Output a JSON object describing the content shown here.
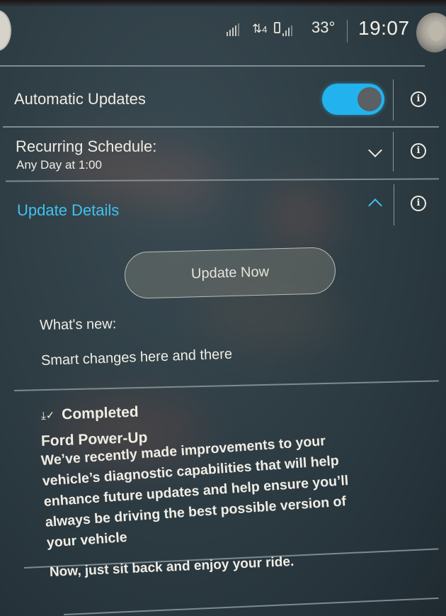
{
  "status_bar": {
    "icons": [
      "signal-bars-icon",
      "data-transfer-icon",
      "phone-signal-icon"
    ],
    "data_transfer_label": "4",
    "temperature": "33°",
    "time": "19:07",
    "avatar": "user-avatar"
  },
  "settings": {
    "automatic_updates": {
      "label": "Automatic Updates",
      "enabled": true
    },
    "recurring_schedule": {
      "label": "Recurring Schedule:",
      "value": "Any Day at 1:00",
      "expanded": false
    },
    "update_details": {
      "label": "Update Details",
      "expanded": true
    }
  },
  "details": {
    "update_now_label": "Update Now",
    "whats_new_label": "What's new:",
    "whats_new_text": "Smart changes here and there",
    "status_label": "Completed",
    "update_name": "Ford Power-Up",
    "description": "We’ve recently made improvements to your vehicle’s diagnostic capabilities that will help enhance future updates and help ensure you’ll always be driving the best possible version of your vehicle",
    "closing_text": "Now, just sit back and enjoy your ride."
  },
  "colors": {
    "accent": "#3EC2F0",
    "toggle_on": "#22B3EE",
    "background": "#2F3E45"
  }
}
